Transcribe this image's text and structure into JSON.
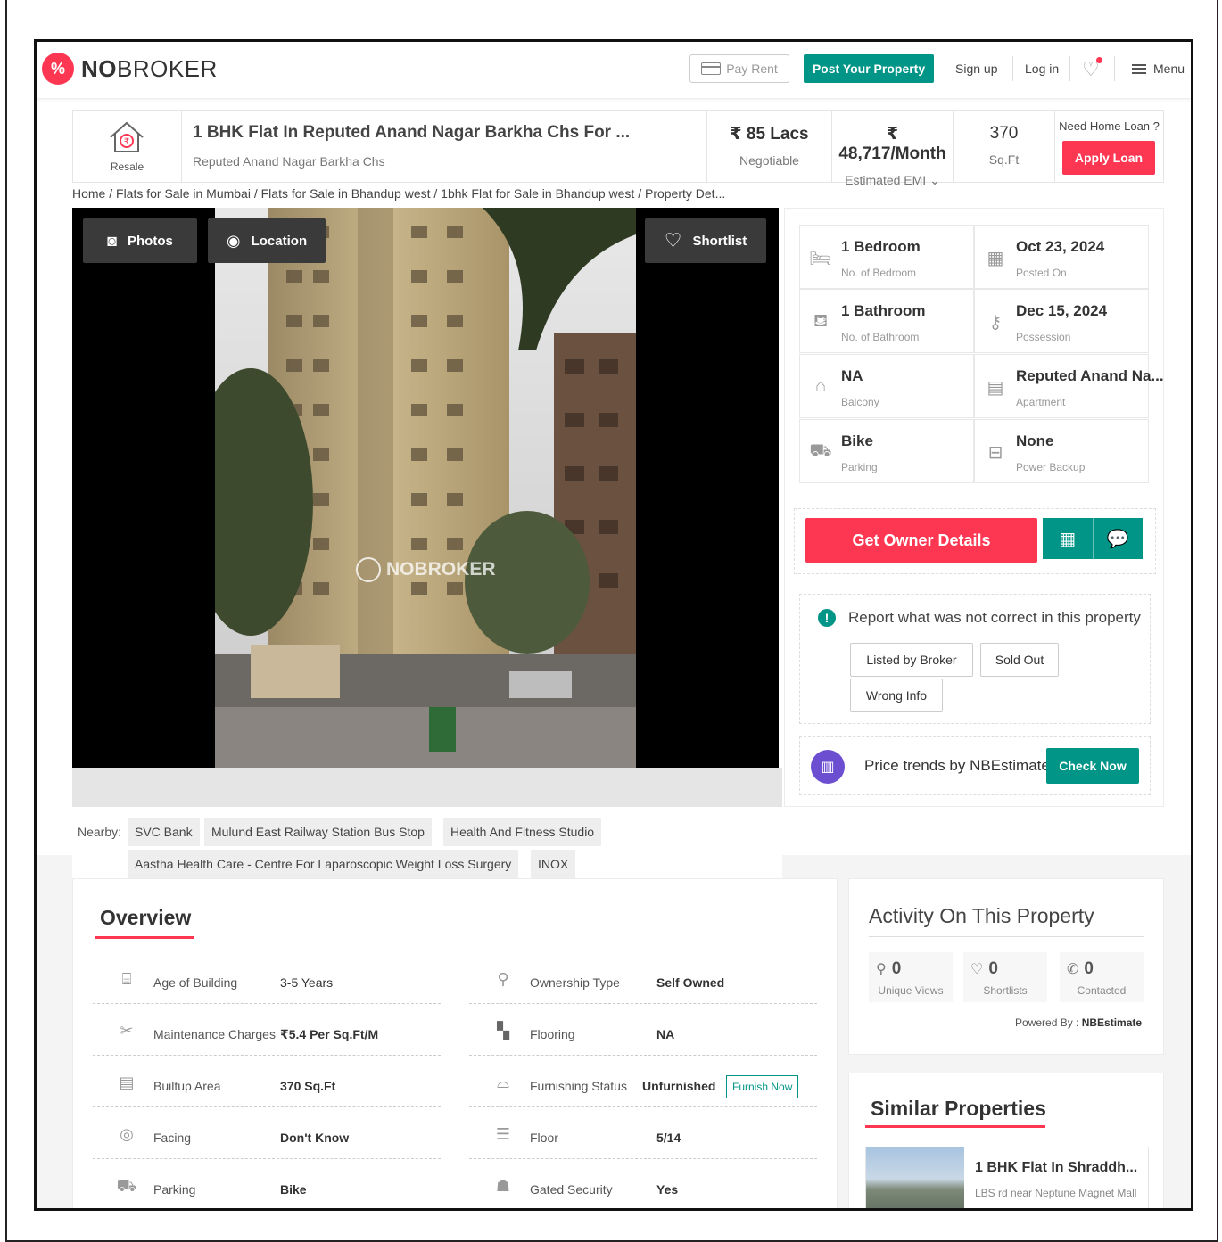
{
  "brand": {
    "logo_text_bold": "NO",
    "logo_text_regular": "BROKER",
    "accent": "#fd3752",
    "green": "#009587"
  },
  "header": {
    "pay_rent": "Pay Rent",
    "post_property": "Post Your Property",
    "sign_up": "Sign up",
    "log_in": "Log in",
    "menu": "Menu"
  },
  "summary": {
    "type_label": "Resale",
    "title": "1 BHK Flat In Reputed Anand Nagar Barkha Chs For ...",
    "subtitle": "Reputed Anand Nagar Barkha Chs",
    "price": "₹ 85 Lacs",
    "price_sub": "Negotiable",
    "emi": "₹ 48,717/Month",
    "emi_sub": "Estimated EMI",
    "area": "370",
    "area_sub": "Sq.Ft",
    "loan_question": "Need Home Loan ?",
    "apply_loan": "Apply Loan"
  },
  "breadcrumb": "Home / Flats for Sale in Mumbai / Flats for Sale in Bhandup west / 1bhk Flat for Sale in Bhandup west / Property Det...",
  "gallery": {
    "photos": "Photos",
    "location": "Location",
    "shortlist": "Shortlist",
    "watermark": "NOBROKER"
  },
  "details": [
    {
      "value": "1 Bedroom",
      "label": "No. of Bedroom",
      "icon": "bed-icon"
    },
    {
      "value": "Oct 23, 2024",
      "label": "Posted On",
      "icon": "calendar-icon"
    },
    {
      "value": "1 Bathroom",
      "label": "No. of Bathroom",
      "icon": "bathtub-icon"
    },
    {
      "value": "Dec 15, 2024",
      "label": "Possession",
      "icon": "key-icon"
    },
    {
      "value": "NA",
      "label": "Balcony",
      "icon": "balcony-icon"
    },
    {
      "value": "Reputed Anand Na...",
      "label": "Apartment",
      "icon": "building-icon"
    },
    {
      "value": "Bike",
      "label": "Parking",
      "icon": "car-icon"
    },
    {
      "value": "None",
      "label": "Power Backup",
      "icon": "battery-icon"
    }
  ],
  "owner": {
    "get_owner_details": "Get Owner Details"
  },
  "report": {
    "heading": "Report what was not correct in this property",
    "chips": [
      "Listed by Broker",
      "Sold Out",
      "Wrong Info"
    ]
  },
  "trend": {
    "text": "Price trends by NBEstimate",
    "button": "Check Now"
  },
  "nearby": {
    "label": "Nearby:",
    "places": [
      "SVC Bank",
      "Mulund East Railway Station Bus Stop",
      "Health And Fitness Studio",
      "Aastha Health Care - Centre For Laparoscopic Weight Loss Surgery",
      "INOX"
    ]
  },
  "overview": {
    "title": "Overview",
    "left": [
      {
        "key": "Age of Building",
        "value": "3-5 Years"
      },
      {
        "key": "Maintenance Charges",
        "value": "₹5.4 Per Sq.Ft/M"
      },
      {
        "key": "Builtup Area",
        "value": "370 Sq.Ft"
      },
      {
        "key": "Facing",
        "value": "Don't Know"
      },
      {
        "key": "Parking",
        "value": "Bike"
      }
    ],
    "right": [
      {
        "key": "Ownership Type",
        "value": "Self Owned"
      },
      {
        "key": "Flooring",
        "value": "NA"
      },
      {
        "key": "Furnishing Status",
        "value": "Unfurnished"
      },
      {
        "key": "Floor",
        "value": "5/14"
      },
      {
        "key": "Gated Security",
        "value": "Yes"
      }
    ],
    "furnish_now": "Furnish Now"
  },
  "activity": {
    "title": "Activity On This Property",
    "stats": [
      {
        "count": "0",
        "label": "Unique Views"
      },
      {
        "count": "0",
        "label": "Shortlists"
      },
      {
        "count": "0",
        "label": "Contacted"
      }
    ],
    "powered_by": "Powered By :",
    "powered_name": "NBEstimate"
  },
  "similar": {
    "title": "Similar Properties",
    "item_name": "1 BHK Flat In Shraddh...",
    "item_location": "LBS rd near Neptune Magnet Mall"
  }
}
